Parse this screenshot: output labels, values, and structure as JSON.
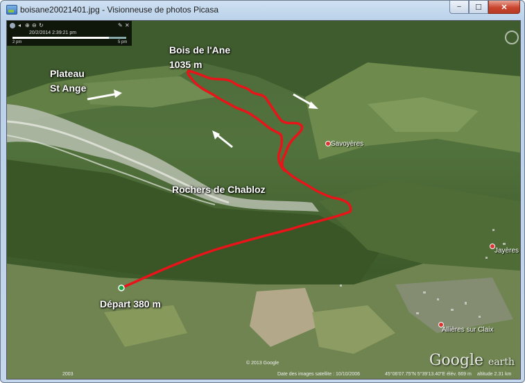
{
  "window": {
    "title": "boisane20021401.jpg - Visionneuse de photos Picasa",
    "buttons": {
      "minimize": "−",
      "maximize": "☐",
      "close": "✕"
    }
  },
  "photo": {
    "labels": {
      "bois": "Bois de l'Ane",
      "bois_alt": "1035 m",
      "plateau": "Plateau",
      "plateau2": "St Ange",
      "rochers": "Rochers de Chabloz",
      "depart": "Départ 380 m"
    },
    "places": {
      "savoyeres": "Savoyères",
      "jayeres": "Jayères",
      "allieres": "Allières sur Claix"
    },
    "timeslider": {
      "date": "20/2/2014  2:39:21 pm",
      "start": "2 pm",
      "end": "5 pm",
      "progress": 0.85
    },
    "status": {
      "copyright": "© 2013 Google",
      "year": "2003",
      "imagery": "Date des images satellite : 10/10/2006",
      "coords": "45°06'07.75\"N   5°39'13.40\"E   élév.  669 m",
      "altitude": "altitude   2.31 km"
    },
    "logo": {
      "main": "Google",
      "sub": "earth"
    },
    "colors": {
      "track": "#e8141a",
      "accent": "#ffffff"
    }
  }
}
